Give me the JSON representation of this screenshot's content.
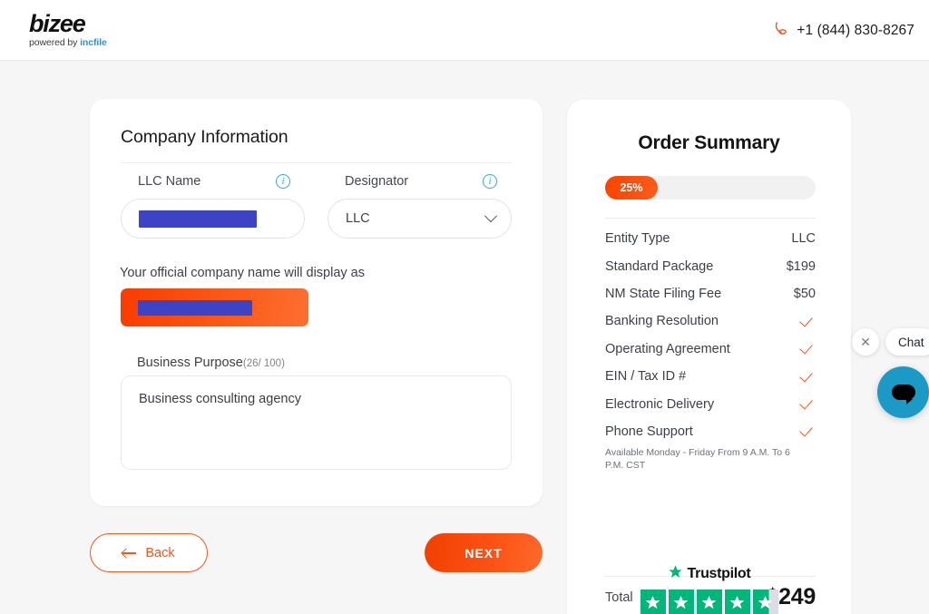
{
  "header": {
    "logo_word": "bizee",
    "logo_sub_prefix": "powered by ",
    "logo_sub_brand": "incfile",
    "phone_icon": "phone-icon",
    "phone": "+1 (844) 830-8267"
  },
  "form": {
    "title": "Company Information",
    "llc_name": {
      "label": "LLC Name",
      "info_icon": "info-icon",
      "value": "",
      "redacted": true
    },
    "designator": {
      "label": "Designator",
      "info_icon": "info-icon",
      "value": "LLC",
      "chevron_icon": "chevron-down-icon"
    },
    "display_as_label": "Your official company name will display as",
    "display_as_value": "",
    "business_purpose": {
      "label": "Business Purpose",
      "counter": "(26/ 100)",
      "value": "Business consulting agency"
    },
    "back_label": "Back",
    "back_icon": "arrow-left-icon",
    "next_label": "NEXT"
  },
  "order": {
    "title": "Order Summary",
    "progress_percent": "25%",
    "progress_value": 25,
    "items": [
      {
        "name": "Entity Type",
        "value": "LLC",
        "check": false
      },
      {
        "name": "Standard Package",
        "value": "$199",
        "check": false
      },
      {
        "name": "NM State Filing Fee",
        "value": "$50",
        "check": false
      },
      {
        "name": "Banking Resolution",
        "value": "",
        "check": true
      },
      {
        "name": "Operating Agreement",
        "value": "",
        "check": true
      },
      {
        "name": "EIN / Tax ID #",
        "value": "",
        "check": true
      },
      {
        "name": "Electronic Delivery",
        "value": "",
        "check": true
      },
      {
        "name": "Phone Support",
        "value": "",
        "check": true
      }
    ],
    "phone_support_note": "Available Monday - Friday From 9 A.M. To 6 P.M. CST",
    "total_label": "Total",
    "total_value": "$249"
  },
  "trustpilot": {
    "name": "Trustpilot",
    "star_icon": "star-icon",
    "stars": 5,
    "partial_last": true
  },
  "chat": {
    "close_icon": "close-icon",
    "label": "Chat",
    "bubble_icon": "chat-bubble-icon"
  },
  "colors": {
    "accent_orange": "#f4561a",
    "info_blue": "#36a8e0",
    "redaction_blue": "#3c44c5",
    "trustpilot_green": "#00b67a",
    "chat_blue": "#1c9ac6",
    "page_bg": "#f6f6f6"
  }
}
